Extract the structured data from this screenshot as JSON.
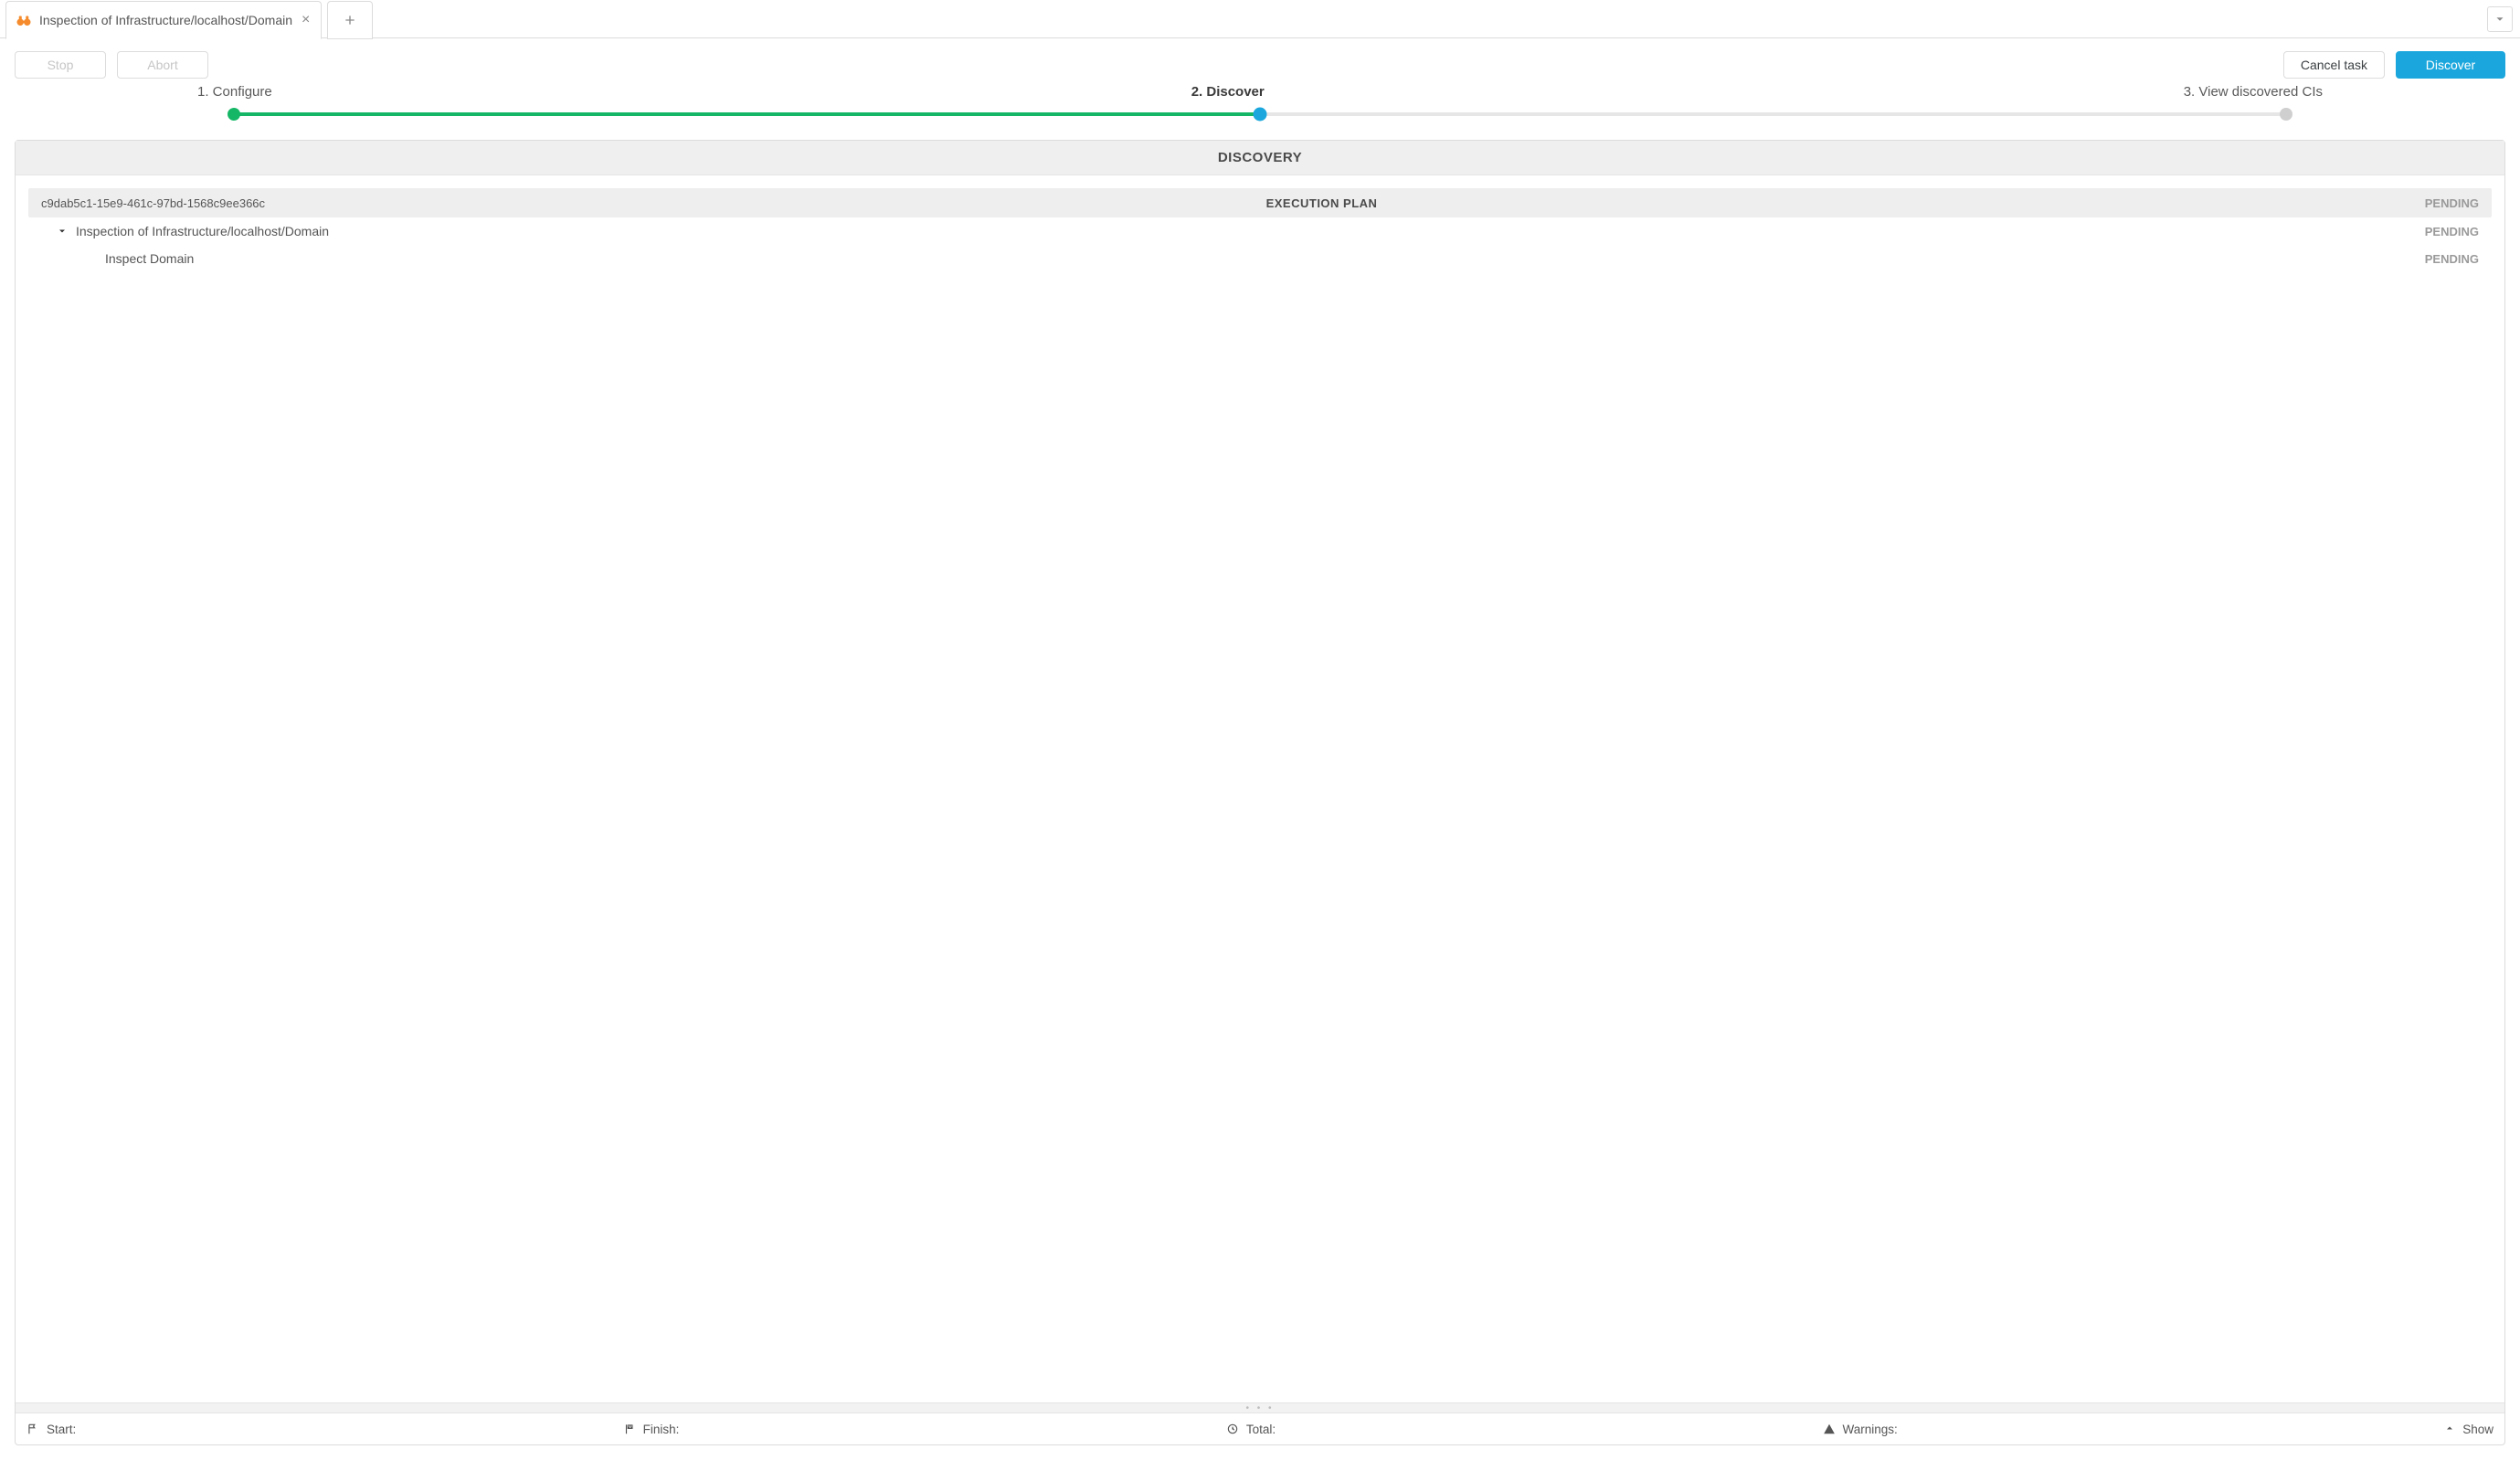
{
  "colors": {
    "primary": "#1ba7dd",
    "green": "#15b766",
    "gray_dot": "#cfcfcf",
    "orange_icon": "#f58b2c"
  },
  "tabs": {
    "items": [
      {
        "title": "Inspection of Infrastructure/localhost/Domain",
        "icon": "binoculars-icon"
      }
    ],
    "overflow_tooltip": ""
  },
  "toolbar": {
    "stop_label": "Stop",
    "abort_label": "Abort",
    "cancel_task_label": "Cancel task",
    "discover_label": "Discover"
  },
  "stepper": {
    "steps": [
      {
        "label": "1. Configure",
        "state": "complete"
      },
      {
        "label": "2. Discover",
        "state": "active"
      },
      {
        "label": "3. View discovered CIs",
        "state": "upcoming"
      }
    ]
  },
  "panel": {
    "title": "DISCOVERY",
    "plan": {
      "id": "c9dab5c1-15e9-461c-97bd-1568c9ee366c",
      "heading": "EXECUTION PLAN",
      "heading_status": "PENDING",
      "rows": [
        {
          "level": 0,
          "label": "Inspection of Infrastructure/localhost/Domain",
          "status": "PENDING",
          "expandable": true,
          "expanded": true
        },
        {
          "level": 1,
          "label": "Inspect Domain",
          "status": "PENDING",
          "expandable": false
        }
      ]
    }
  },
  "statusbar": {
    "start_label": "Start:",
    "finish_label": "Finish:",
    "total_label": "Total:",
    "warnings_label": "Warnings:",
    "show_label": "Show"
  }
}
